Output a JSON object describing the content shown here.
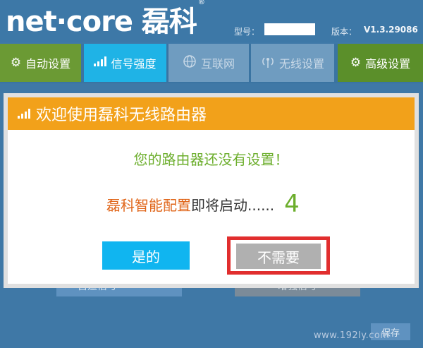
{
  "header": {
    "logo_text": "net·core 磊科",
    "logo_reg": "®",
    "model_label": "型号：",
    "version_label": "版本：",
    "version_value": "V1.3.29086"
  },
  "nav": {
    "tabs": [
      {
        "label": "自动设置",
        "icon": "gear-icon"
      },
      {
        "label": "信号强度",
        "icon": "signal-bars-icon"
      },
      {
        "label": "互联网",
        "icon": "globe-icon"
      },
      {
        "label": "无线设置",
        "icon": "wireless-icon"
      },
      {
        "label": "高级设置",
        "icon": "gear-icon"
      }
    ]
  },
  "background": {
    "left_button": "自适信号",
    "right_button": "增强信号",
    "save_button": "保存",
    "watermark": "www.192ly.com"
  },
  "dialog": {
    "title": "欢迎使用磊科无线路由器",
    "message": "您的路由器还没有设置！",
    "brand_text": "磊科智能配置",
    "launch_text": "即将启动......",
    "countdown": "4",
    "yes_button": "是的",
    "no_button": "不需要"
  },
  "colors": {
    "header_bg": "#3d78a7",
    "dialog_title_bg": "#f2a11a",
    "message_green": "#6cae2c",
    "brand_orange": "#e0661a",
    "yes_blue": "#10b5f0",
    "highlight_red": "#e12e2e"
  }
}
